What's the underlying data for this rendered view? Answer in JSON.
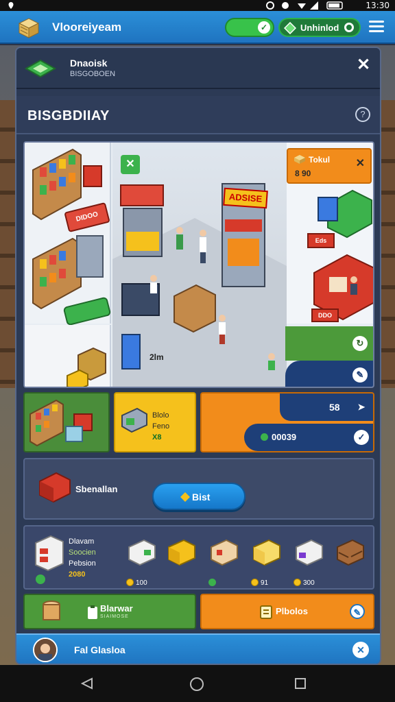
{
  "status_bar": {
    "time": "13:30"
  },
  "app_header": {
    "title": "Vlooreiyeam",
    "toggle_icon": "check-icon",
    "currency_label": "Unhinlod",
    "menu_icon": "hamburger-icon"
  },
  "dialog": {
    "header_name": "Dnaoisk",
    "header_sub": "BISGOBOEN",
    "close_icon": "close-icon",
    "section_title": "BISGBDIIAY",
    "help_icon": "help-icon"
  },
  "scene": {
    "tool_icon": "wrench-icon",
    "store_sign": "ADSISE",
    "left_sign": "DIDOO",
    "kiosk_tag": "2lm",
    "orange_card": {
      "line1": "Tokul",
      "line2": "8 90"
    },
    "badges": [
      "Eds",
      "DDO"
    ]
  },
  "cards": {
    "yellow": {
      "line1": "Blolo",
      "line2": "Feno",
      "line3": "X8"
    },
    "orange": {
      "value1": "58",
      "value2": "00039"
    }
  },
  "action_row": {
    "label": "Sbenallan",
    "button_label": "Bist"
  },
  "inventory": {
    "line1": "Dlavam",
    "line2": "Soocien",
    "line3": "Pebsion",
    "line4": "2080",
    "items": [
      {
        "price": "100",
        "coin": "gold"
      },
      {
        "price": "",
        "coin": ""
      },
      {
        "price": "",
        "coin": "green"
      },
      {
        "price": "91",
        "coin": "gold"
      },
      {
        "price": "300",
        "coin": "gold"
      },
      {
        "price": "",
        "coin": ""
      }
    ]
  },
  "bottom_buttons": {
    "green_label": "Blarwar",
    "green_sub": "SIAIMOSE",
    "orange_label": "Plbolos"
  },
  "footer": {
    "label": "Fal Glasloa"
  },
  "colors": {
    "primary_blue": "#1f74c0",
    "green": "#4c9a3a",
    "orange": "#f28c1b",
    "yellow": "#f5c11c",
    "navy": "#1e3f78",
    "panel": "#2c3a55"
  }
}
